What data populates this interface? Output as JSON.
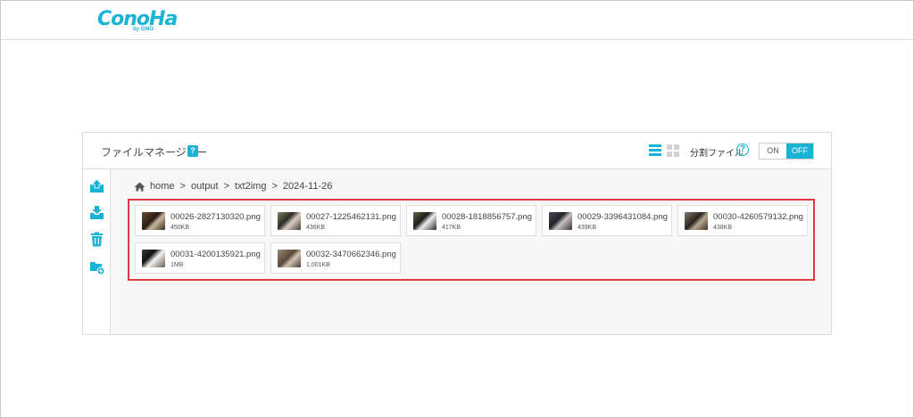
{
  "app": {
    "logo_main": "ConoHa",
    "logo_sub": "by GMO"
  },
  "panel": {
    "title": "ファイルマネージャー",
    "help_mark": "?",
    "split_label": "分割ファイル",
    "split_help_mark": "?",
    "toggle_on": "ON",
    "toggle_off": "OFF",
    "toggle_state": "OFF"
  },
  "sidebar": {
    "icons": [
      "upload-icon",
      "download-icon",
      "trash-icon",
      "new-folder-icon"
    ]
  },
  "breadcrumb": {
    "items": [
      "home",
      "output",
      "txt2img",
      "2024-11-26"
    ],
    "separator": ">"
  },
  "files": [
    {
      "name": "00026-2827130320.png",
      "size": "450KB"
    },
    {
      "name": "00027-1225462131.png",
      "size": "436KB"
    },
    {
      "name": "00028-1818856757.png",
      "size": "417KB"
    },
    {
      "name": "00029-3396431084.png",
      "size": "439KB"
    },
    {
      "name": "00030-4260579132.png",
      "size": "438KB"
    },
    {
      "name": "00031-4200135921.png",
      "size": "1MB"
    },
    {
      "name": "00032-3470662346.png",
      "size": "1,001KB"
    }
  ],
  "colors": {
    "accent": "#19b3d6",
    "selection": "#e23a44"
  }
}
